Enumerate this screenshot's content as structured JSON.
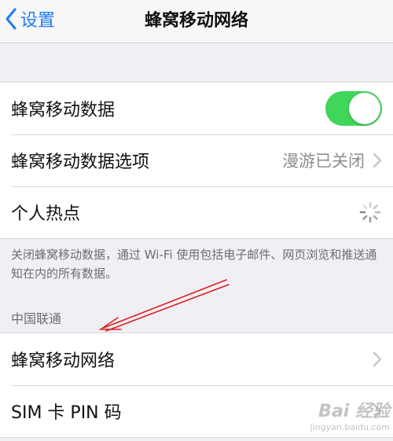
{
  "nav": {
    "back_label": "设置",
    "title": "蜂窝移动网络"
  },
  "group1": {
    "rows": [
      {
        "label": "蜂窝移动数据",
        "control": "toggle",
        "state": "on"
      },
      {
        "label": "蜂窝移动数据选项",
        "value": "漫游已关闭"
      },
      {
        "label": "个人热点",
        "status": "loading"
      }
    ]
  },
  "footnote": "关闭蜂窝移动数据，通过 Wi-Fi 使用包括电子邮件、网页浏览和推送通知在内的所有数据。",
  "section": {
    "header": "中国联通",
    "rows": [
      {
        "label": "蜂窝移动网络"
      },
      {
        "label": "SIM 卡 PIN 码"
      }
    ]
  },
  "watermark": {
    "main": "Bai 经验",
    "sub": "jingyan.baidu.com"
  },
  "colors": {
    "accent": "#1f7cf2",
    "toggle_on": "#3fd65a",
    "annotation_arrow": "#e02020",
    "background": "#efeff4"
  },
  "icons": [
    "chevron-left-icon",
    "chevron-right-icon",
    "loading-spinner-icon"
  ]
}
